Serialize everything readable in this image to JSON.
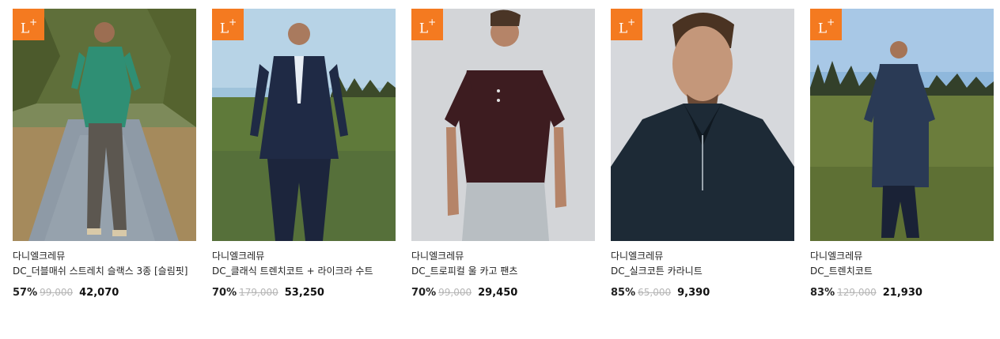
{
  "badge": {
    "letter": "L",
    "plus": "+"
  },
  "products": [
    {
      "brand": "다니엘크레뮤",
      "name": "DC_더블매쉬 스트레치 슬랙스 3종 [슬림핏]",
      "discount": "57%",
      "original_price": "99,000",
      "sale_price": "42,070"
    },
    {
      "brand": "다니엘크레뮤",
      "name": "DC_클래식 트렌치코트 + 라이크라 수트",
      "discount": "70%",
      "original_price": "179,000",
      "sale_price": "53,250"
    },
    {
      "brand": "다니엘크레뮤",
      "name": "DC_트로피컬 울 카고 팬츠",
      "discount": "70%",
      "original_price": "99,000",
      "sale_price": "29,450"
    },
    {
      "brand": "다니엘크레뮤",
      "name": "DC_실크코튼 카라니트",
      "discount": "85%",
      "original_price": "65,000",
      "sale_price": "9,390"
    },
    {
      "brand": "다니엘크레뮤",
      "name": "DC_트렌치코트",
      "discount": "83%",
      "original_price": "129,000",
      "sale_price": "21,930"
    }
  ],
  "colors": {
    "badge": "#f47a20",
    "strikethrough": "#b5b5b5"
  }
}
